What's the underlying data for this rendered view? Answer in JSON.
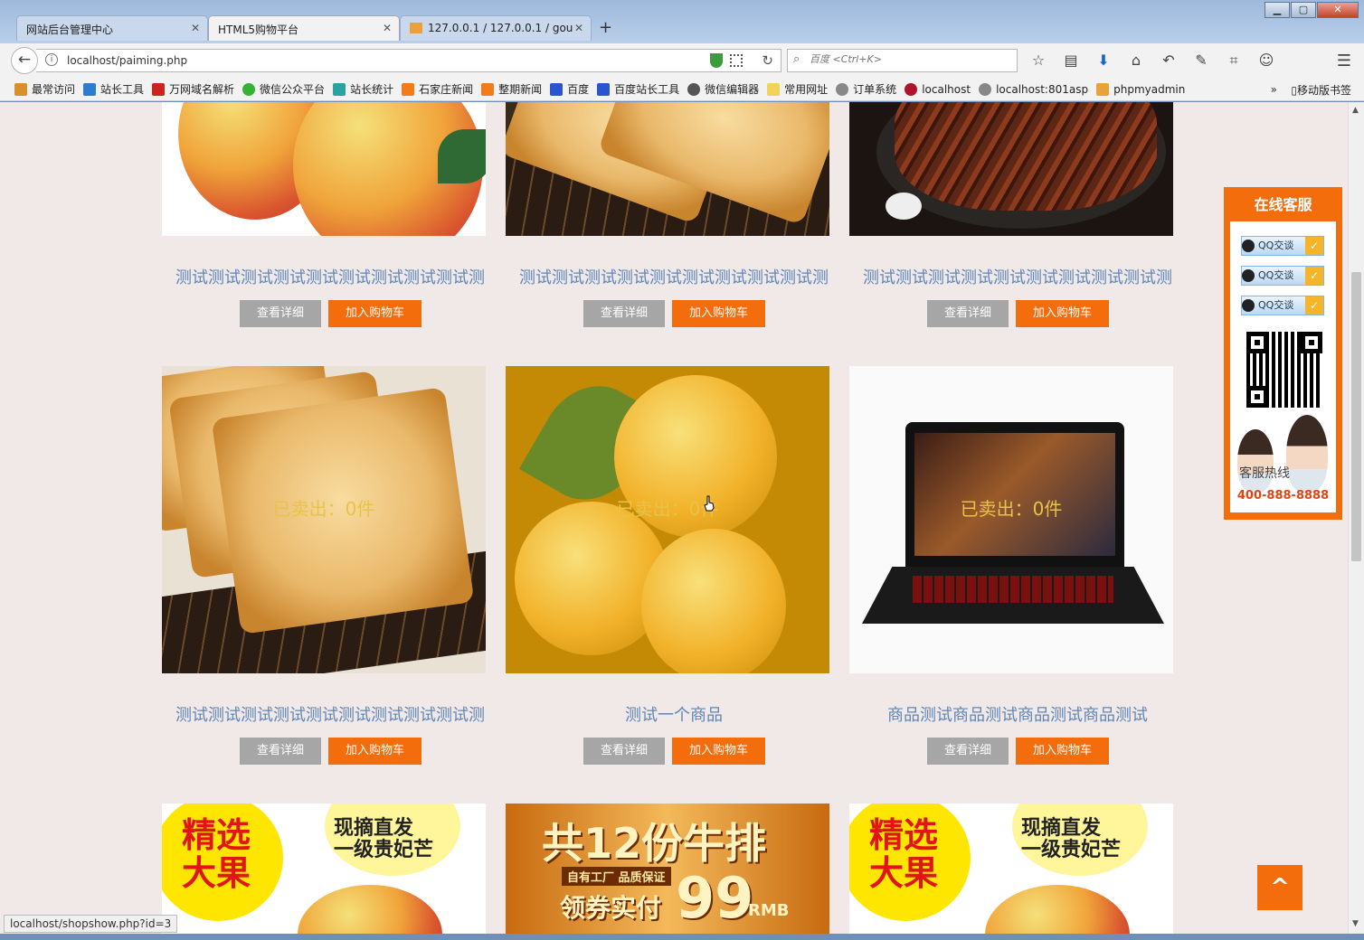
{
  "browser": {
    "tabs": [
      {
        "title": "网站后台管理中心",
        "active": false
      },
      {
        "title": "HTML5购物平台",
        "active": true
      },
      {
        "title": "127.0.0.1 / 127.0.0.1 / gou",
        "active": false
      }
    ],
    "new_tab": "+",
    "url": "localhost/paiming.php",
    "search_placeholder": "百度 <Ctrl+K>",
    "bookmarks": [
      "最常访问",
      "站长工具",
      "万网域名解析",
      "微信公众平台",
      "站长统计",
      "石家庄新闻",
      "整期新闻",
      "百度",
      "百度站长工具",
      "微信编辑器",
      "常用网址",
      "订单系统",
      "localhost",
      "localhost:801asp",
      "phpmyadmin"
    ],
    "bookmarks_more": "»",
    "mobile_bookmarks": "移动版书签",
    "status_url": "localhost/shopshow.php?id=3"
  },
  "products": [
    {
      "name": "测试测试测试测试测试测试测试测试测试测",
      "sold": "",
      "detail": "查看详细",
      "cart": "加入购物车"
    },
    {
      "name": "测试测试测试测试测试测试测试测试测试测",
      "sold": "",
      "detail": "查看详细",
      "cart": "加入购物车"
    },
    {
      "name": "测试测试测试测试测试测试测试测试测试测",
      "sold": "",
      "detail": "查看详细",
      "cart": "加入购物车"
    },
    {
      "name": "测试测试测试测试测试测试测试测试测试测",
      "sold": "已卖出：0件",
      "detail": "查看详细",
      "cart": "加入购物车"
    },
    {
      "name": "测试一个商品",
      "sold": "已卖出：0件",
      "detail": "查看详细",
      "cart": "加入购物车"
    },
    {
      "name": "商品测试商品测试商品测试商品测试",
      "sold": "已卖出：0件",
      "detail": "查看详细",
      "cart": "加入购物车"
    }
  ],
  "banners": [
    {
      "big": "精选\n大果",
      "small": "现摘直发\n一级贵妃芒"
    },
    {
      "big": "共12份牛排",
      "small": "自有工厂 品质保证",
      "price_label": "领券实付",
      "price": "99",
      "unit": "RMB"
    },
    {
      "big": "精选\n大果",
      "small": "现摘直发\n一级贵妃芒"
    }
  ],
  "service": {
    "title": "在线客服",
    "qq_buttons": [
      "QQ交谈",
      "QQ交谈",
      "QQ交谈"
    ],
    "hotline_label": "客服热线",
    "hotline": "400-888-8888"
  },
  "back_to_top": "^",
  "colors": {
    "accent": "#f46d0c",
    "link": "#5d86b9",
    "page_bg": "#f1e8e8"
  }
}
